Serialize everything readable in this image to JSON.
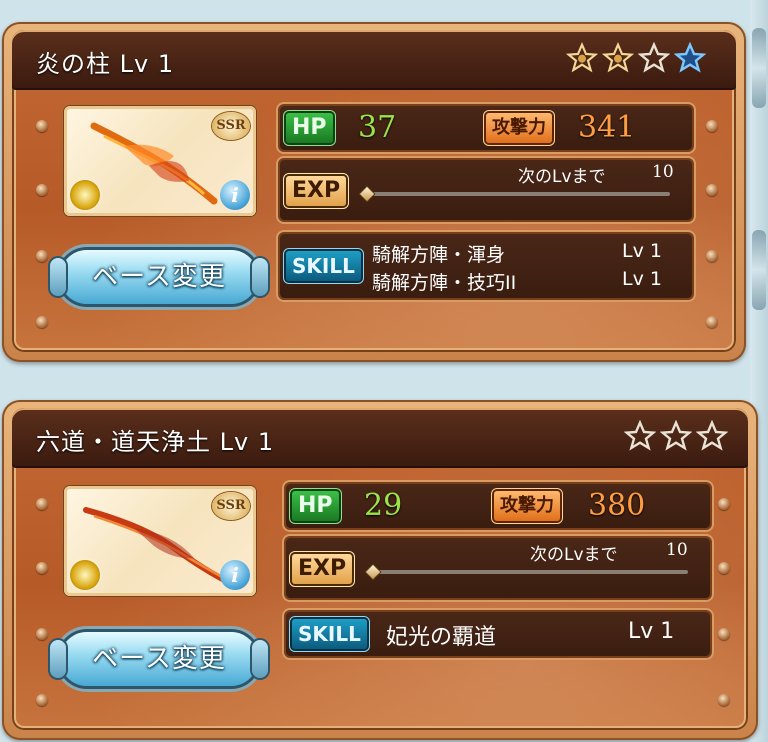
{
  "weapons": [
    {
      "title": "炎の柱 Lv 1",
      "stars": [
        "uncap-star-filled",
        "uncap-star-filled",
        "uncap-star-empty",
        "uncap-star-blue"
      ],
      "rarity": "SSR",
      "base_button": "ベース変更",
      "hp_label": "HP",
      "hp": "37",
      "atk_label": "攻撃力",
      "atk": "341",
      "exp_label": "EXP",
      "next_lv_label": "次のLvまで",
      "next_lv_value": "10",
      "exp_progress": 0,
      "skill_label": "SKILL",
      "skills": [
        {
          "name": "騎解方陣・渾身",
          "level": "Lv 1"
        },
        {
          "name": "騎解方陣・技巧II",
          "level": "Lv 1"
        }
      ]
    },
    {
      "title": "六道・道天浄土 Lv 1",
      "stars": [
        "uncap-star-empty",
        "uncap-star-empty",
        "uncap-star-empty"
      ],
      "rarity": "SSR",
      "base_button": "ベース変更",
      "hp_label": "HP",
      "hp": "29",
      "atk_label": "攻撃力",
      "atk": "380",
      "exp_label": "EXP",
      "next_lv_label": "次のLvまで",
      "next_lv_value": "10",
      "exp_progress": 0,
      "skill_label": "SKILL",
      "skills": [
        {
          "name": "妃光の覇道",
          "level": "Lv 1"
        }
      ]
    }
  ]
}
